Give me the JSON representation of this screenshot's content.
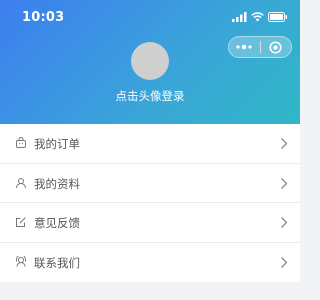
{
  "status_bar": {
    "time": "10:03"
  },
  "profile": {
    "login_prompt": "点击头像登录"
  },
  "menu": {
    "items": [
      {
        "label": "我的订单",
        "icon": "order-icon"
      },
      {
        "label": "我的资料",
        "icon": "user-icon"
      },
      {
        "label": "意见反馈",
        "icon": "feedback-icon"
      },
      {
        "label": "联系我们",
        "icon": "contact-icon"
      }
    ]
  },
  "colors": {
    "header_gradient_start": "#3d7ef0",
    "header_gradient_end": "#2fb8c6",
    "background": "#f2f3f5",
    "text": "#555555"
  }
}
